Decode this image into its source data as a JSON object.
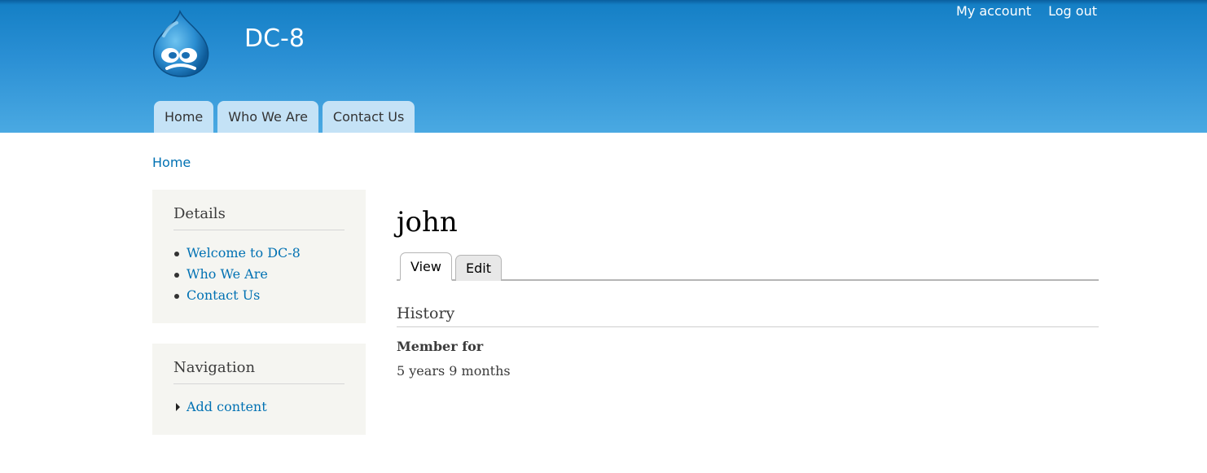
{
  "site": {
    "name": "DC-8",
    "logo_icon": "drupal-drop-logo-icon"
  },
  "secondary_menu": {
    "my_account": "My account",
    "log_out": "Log out"
  },
  "main_menu": [
    {
      "label": "Home"
    },
    {
      "label": "Who We Are"
    },
    {
      "label": "Contact Us"
    }
  ],
  "breadcrumb": {
    "home": "Home"
  },
  "sidebar": {
    "details": {
      "title": "Details",
      "items": [
        {
          "label": "Welcome to DC-8"
        },
        {
          "label": "Who We Are"
        },
        {
          "label": "Contact Us"
        }
      ]
    },
    "navigation": {
      "title": "Navigation",
      "items": [
        {
          "label": "Add content"
        }
      ]
    }
  },
  "main": {
    "title": "john",
    "tabs": [
      {
        "label": "View",
        "active": true
      },
      {
        "label": "Edit",
        "active": false
      }
    ],
    "history": {
      "title": "History",
      "member_for_label": "Member for",
      "member_for_value": "5 years 9 months"
    }
  },
  "colors": {
    "header_top": "#0a5e9e",
    "header_bottom": "#4aa9e2",
    "link": "#0071b3",
    "tab_bg": "#c4e2f6",
    "sidebar_bg": "#f5f5f1"
  }
}
